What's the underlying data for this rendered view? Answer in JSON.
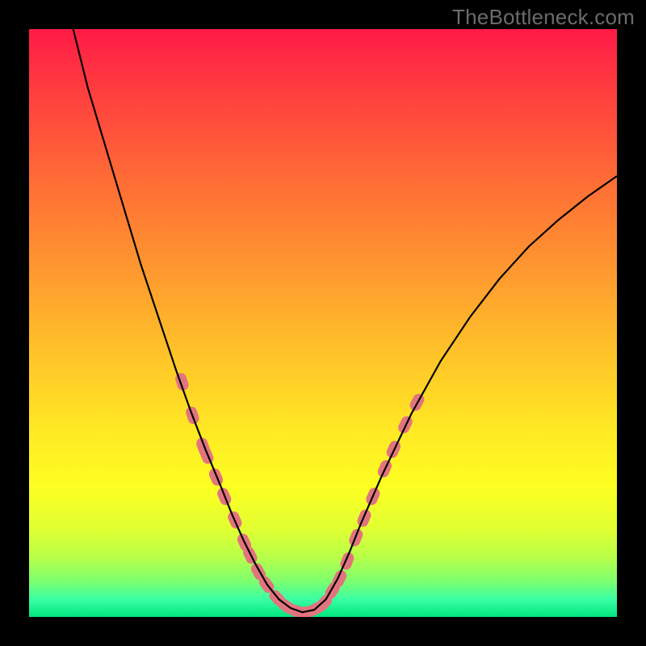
{
  "watermark": "TheBottleneck.com",
  "colors": {
    "frame": "#000000",
    "curve_stroke": "#000000",
    "marker_fill": "#e2747e",
    "gradient_stops": [
      {
        "offset": 0.0,
        "color": "#ff1a47"
      },
      {
        "offset": 0.1,
        "color": "#ff3c3f"
      },
      {
        "offset": 0.25,
        "color": "#ff6a36"
      },
      {
        "offset": 0.4,
        "color": "#ff9530"
      },
      {
        "offset": 0.55,
        "color": "#ffc229"
      },
      {
        "offset": 0.68,
        "color": "#ffe824"
      },
      {
        "offset": 0.78,
        "color": "#fdff22"
      },
      {
        "offset": 0.85,
        "color": "#e1ff32"
      },
      {
        "offset": 0.9,
        "color": "#b6ff4a"
      },
      {
        "offset": 0.94,
        "color": "#7bff70"
      },
      {
        "offset": 0.97,
        "color": "#3affa4"
      },
      {
        "offset": 1.0,
        "color": "#00e57e"
      }
    ]
  },
  "chart_data": {
    "type": "line",
    "title": "",
    "xlabel": "",
    "ylabel": "",
    "x_range_normalized": [
      0,
      1
    ],
    "y_range_normalized": [
      0,
      1
    ],
    "note": "Axes are unlabeled; values are expressed as fractions of the plot area (0 at left/bottom, 1 at right/top).",
    "series": [
      {
        "name": "bottleneck-curve",
        "x": [
          0.075,
          0.1,
          0.13,
          0.16,
          0.19,
          0.22,
          0.25,
          0.275,
          0.3,
          0.325,
          0.345,
          0.365,
          0.385,
          0.405,
          0.425,
          0.445,
          0.465,
          0.485,
          0.505,
          0.525,
          0.545,
          0.565,
          0.6,
          0.65,
          0.7,
          0.75,
          0.8,
          0.85,
          0.9,
          0.95,
          1.0
        ],
        "y": [
          1.0,
          0.9,
          0.8,
          0.7,
          0.6,
          0.51,
          0.42,
          0.35,
          0.285,
          0.225,
          0.175,
          0.13,
          0.09,
          0.055,
          0.03,
          0.015,
          0.008,
          0.012,
          0.03,
          0.065,
          0.11,
          0.16,
          0.24,
          0.345,
          0.435,
          0.51,
          0.575,
          0.63,
          0.675,
          0.715,
          0.75
        ]
      }
    ],
    "markers": {
      "name": "highlighted-segments",
      "style": "rounded-bars",
      "points": [
        {
          "x": 0.26,
          "y": 0.4
        },
        {
          "x": 0.278,
          "y": 0.343
        },
        {
          "x": 0.296,
          "y": 0.29
        },
        {
          "x": 0.302,
          "y": 0.275
        },
        {
          "x": 0.318,
          "y": 0.238
        },
        {
          "x": 0.332,
          "y": 0.205
        },
        {
          "x": 0.35,
          "y": 0.165
        },
        {
          "x": 0.366,
          "y": 0.127
        },
        {
          "x": 0.376,
          "y": 0.105
        },
        {
          "x": 0.39,
          "y": 0.077
        },
        {
          "x": 0.404,
          "y": 0.055
        },
        {
          "x": 0.422,
          "y": 0.032
        },
        {
          "x": 0.438,
          "y": 0.018
        },
        {
          "x": 0.455,
          "y": 0.01
        },
        {
          "x": 0.47,
          "y": 0.008
        },
        {
          "x": 0.488,
          "y": 0.014
        },
        {
          "x": 0.502,
          "y": 0.024
        },
        {
          "x": 0.516,
          "y": 0.045
        },
        {
          "x": 0.528,
          "y": 0.065
        },
        {
          "x": 0.541,
          "y": 0.095
        },
        {
          "x": 0.556,
          "y": 0.135
        },
        {
          "x": 0.57,
          "y": 0.168
        },
        {
          "x": 0.585,
          "y": 0.205
        },
        {
          "x": 0.605,
          "y": 0.252
        },
        {
          "x": 0.62,
          "y": 0.285
        },
        {
          "x": 0.64,
          "y": 0.327
        },
        {
          "x": 0.66,
          "y": 0.365
        }
      ]
    }
  }
}
